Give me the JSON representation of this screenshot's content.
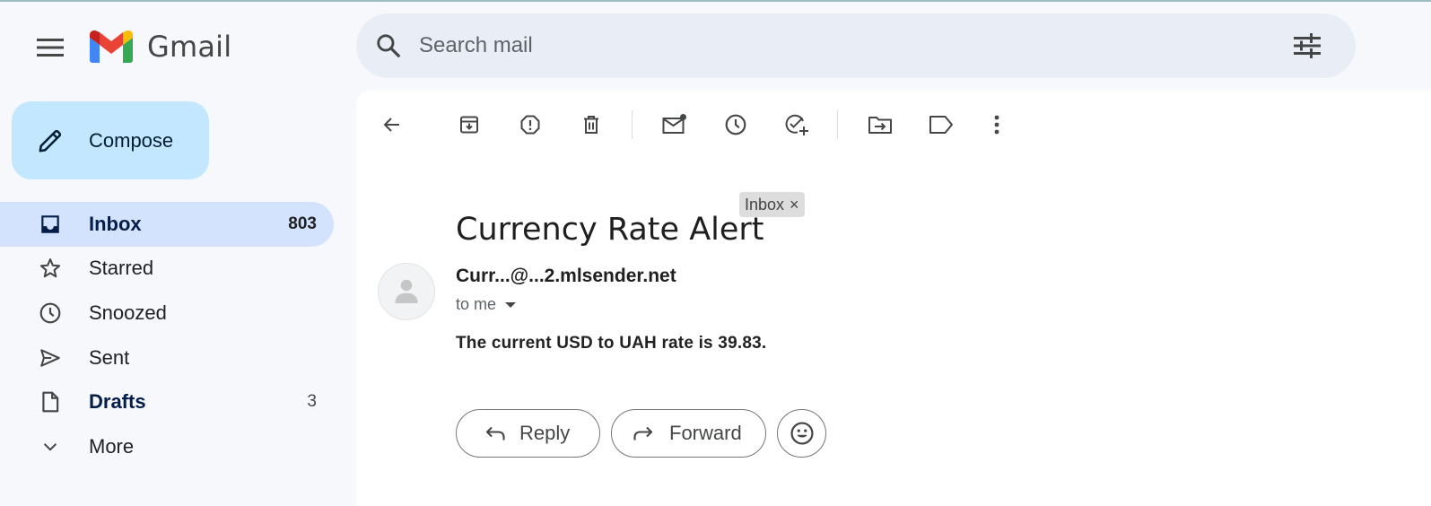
{
  "app": {
    "name": "Gmail"
  },
  "search": {
    "placeholder": "Search mail"
  },
  "compose": {
    "label": "Compose"
  },
  "sidebar": {
    "items": [
      {
        "label": "Inbox",
        "count": "803",
        "icon": "inbox-icon"
      },
      {
        "label": "Starred",
        "count": "",
        "icon": "star-icon"
      },
      {
        "label": "Snoozed",
        "count": "",
        "icon": "clock-icon"
      },
      {
        "label": "Sent",
        "count": "",
        "icon": "send-icon"
      },
      {
        "label": "Drafts",
        "count": "3",
        "icon": "draft-icon"
      },
      {
        "label": "More",
        "count": "",
        "icon": "chevron-down-icon"
      }
    ]
  },
  "toolbar": {
    "icons": [
      "back-arrow-icon",
      "archive-icon",
      "report-spam-icon",
      "delete-icon",
      "mark-unread-icon",
      "snooze-icon",
      "add-to-tasks-icon",
      "move-to-icon",
      "label-icon",
      "more-vert-icon"
    ]
  },
  "message": {
    "subject": "Currency Rate Alert",
    "label_chip": "Inbox",
    "chip_close": "×",
    "sender": "Curr...@...2.mlsender.net",
    "recipient": "to me",
    "body": "The current USD to UAH rate is 39.83."
  },
  "actions": {
    "reply": "Reply",
    "forward": "Forward",
    "emoji_icon": "emoji-smile-icon"
  },
  "colors": {
    "accent_compose": "#c2e7ff",
    "active_nav": "#d3e3fd",
    "search_bg": "#e9eef6"
  }
}
